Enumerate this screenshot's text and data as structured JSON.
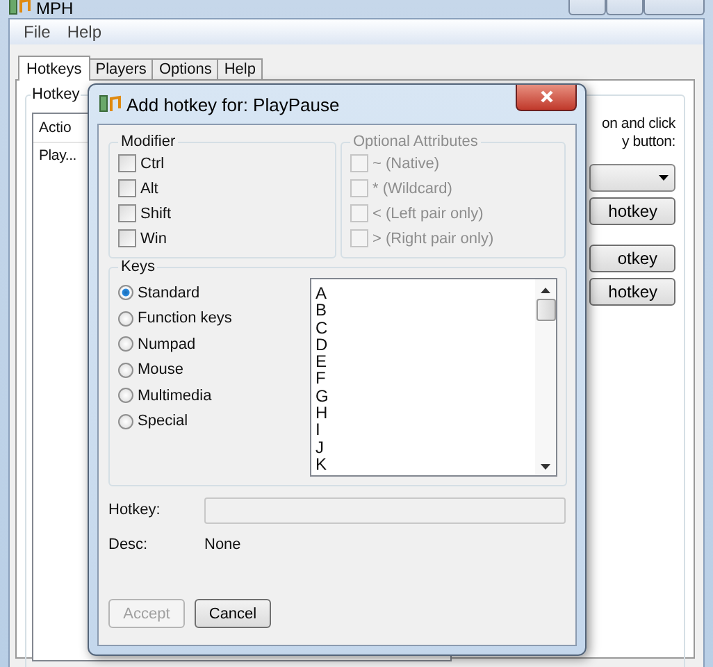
{
  "window": {
    "title": "MPH"
  },
  "menu": [
    "File",
    "Help"
  ],
  "tabs": [
    {
      "label": "Hotkeys",
      "selected": true
    },
    {
      "label": "Players",
      "selected": false
    },
    {
      "label": "Options",
      "selected": false
    },
    {
      "label": "Help",
      "selected": false
    }
  ],
  "hotkey_group": {
    "title": "Hotkey",
    "columns": [
      "Actio"
    ],
    "rows": [
      "Play..."
    ]
  },
  "side": {
    "instruction": [
      "on and click",
      "y button:"
    ],
    "buttons": [
      "hotkey",
      "otkey",
      "hotkey"
    ]
  },
  "dialog": {
    "title": "Add hotkey for: PlayPause",
    "modifier": {
      "title": "Modifier",
      "options": [
        {
          "label": "Ctrl",
          "checked": false
        },
        {
          "label": "Alt",
          "checked": false
        },
        {
          "label": "Shift",
          "checked": false
        },
        {
          "label": "Win",
          "checked": false
        }
      ]
    },
    "optional": {
      "title": "Optional Attributes",
      "disabled": true,
      "options": [
        {
          "label": "~ (Native)",
          "checked": false
        },
        {
          "label": "*  (Wildcard)",
          "checked": false
        },
        {
          "label": "< (Left pair only)",
          "checked": false
        },
        {
          "label": "> (Right pair only)",
          "checked": false
        }
      ]
    },
    "keys": {
      "title": "Keys",
      "types": [
        {
          "label": "Standard",
          "selected": true
        },
        {
          "label": "Function keys",
          "selected": false
        },
        {
          "label": "Numpad",
          "selected": false
        },
        {
          "label": "Mouse",
          "selected": false
        },
        {
          "label": "Multimedia",
          "selected": false
        },
        {
          "label": "Special",
          "selected": false
        }
      ],
      "list": [
        "A",
        "B",
        "C",
        "D",
        "E",
        "F",
        "G",
        "H",
        "I",
        "J",
        "K"
      ]
    },
    "hotkey_label": "Hotkey:",
    "desc": {
      "label": "Desc:",
      "value": "None"
    },
    "buttons": [
      {
        "label": "Accept",
        "disabled": true
      },
      {
        "label": "Cancel",
        "disabled": false
      }
    ]
  }
}
